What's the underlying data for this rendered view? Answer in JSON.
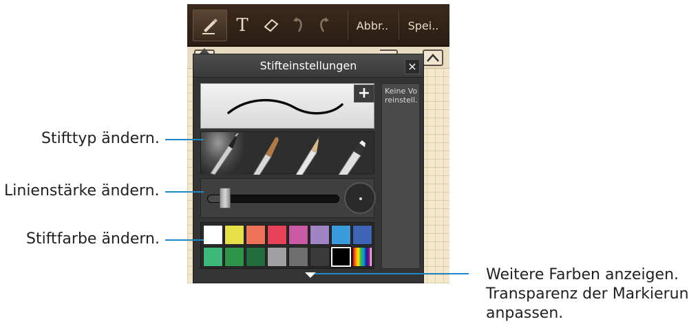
{
  "toolbar": {
    "items": [
      {
        "name": "pen-tool",
        "icon": "pen-icon",
        "active": true
      },
      {
        "name": "text-tool",
        "icon": "text-T-icon",
        "label": "T"
      },
      {
        "name": "eraser-tool",
        "icon": "eraser-icon"
      },
      {
        "name": "undo",
        "icon": "undo-icon"
      },
      {
        "name": "redo",
        "icon": "redo-icon"
      }
    ],
    "cancel_label": "Abbr..",
    "save_label": "Spei.."
  },
  "popup": {
    "title": "Stifteinstellungen",
    "close_icon": "×",
    "add_icon": "+",
    "presets_text": "Keine Vo reinstell.",
    "pen_types": [
      "fountain-pen",
      "brush",
      "pencil",
      "marker"
    ],
    "selected_pen_type": "fountain-pen",
    "thickness_level": 0.1,
    "colors": [
      "#ffffff",
      "#e8e04a",
      "#ef7358",
      "#e8425a",
      "#c95aa4",
      "#a184c4",
      "#3b9bdc",
      "#3f64b5",
      "#3cb878",
      "#2e9447",
      "#226b3b",
      "#a0a0a0",
      "#6e6e6e",
      "#3a3a3a",
      "#000000",
      "rainbow"
    ],
    "selected_color": "#000000"
  },
  "callouts": {
    "pen_type": "Stifttyp ändern.",
    "thickness": "Linienstärke ändern.",
    "color": "Stiftfarbe ändern.",
    "more_colors_1": "Weitere Farben anzeigen.",
    "more_colors_2": "Transparenz der Markierung",
    "more_colors_3": "anpassen."
  },
  "accent_color": "#1a88c9"
}
